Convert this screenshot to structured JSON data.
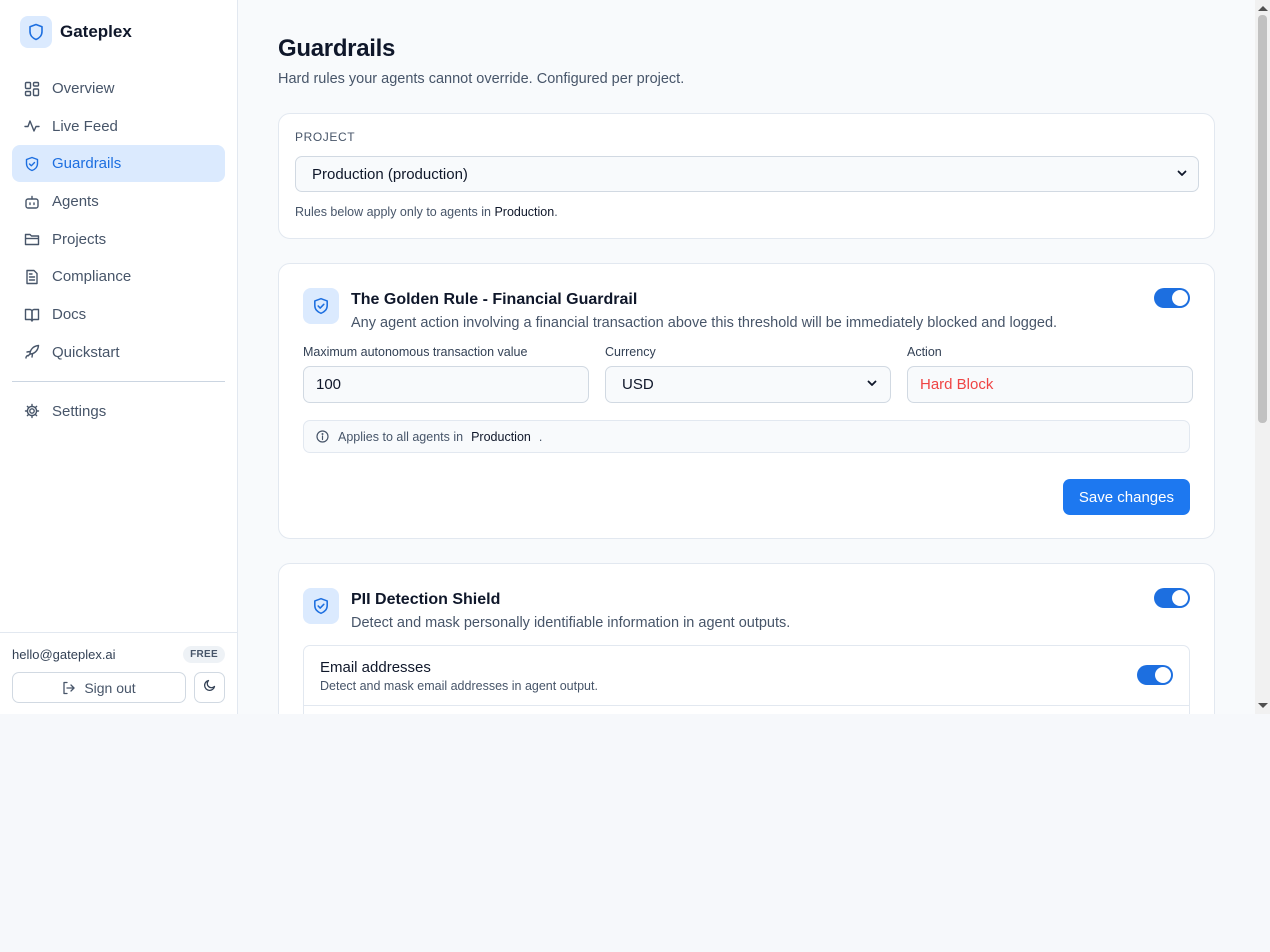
{
  "brand": {
    "name": "Gateplex",
    "icon": "shield-icon"
  },
  "sidebar": {
    "items": [
      {
        "label": "Overview",
        "icon": "dashboard-grid-icon"
      },
      {
        "label": "Live Feed",
        "icon": "activity-icon"
      },
      {
        "label": "Guardrails",
        "icon": "shield-check-icon",
        "active": true
      },
      {
        "label": "Agents",
        "icon": "bot-icon"
      },
      {
        "label": "Projects",
        "icon": "folder-icon"
      },
      {
        "label": "Compliance",
        "icon": "document-icon"
      },
      {
        "label": "Docs",
        "icon": "book-icon"
      },
      {
        "label": "Quickstart",
        "icon": "rocket-icon"
      }
    ],
    "settings_label": "Settings",
    "user_email": "hello@gateplex.ai",
    "plan": "FREE",
    "sign_out_label": "Sign out"
  },
  "page": {
    "title": "Guardrails",
    "subtitle": "Hard rules your agents cannot override. Configured per project."
  },
  "project": {
    "label": "PROJECT",
    "selected": "Production (production)",
    "hint_prefix": "Rules below apply only to agents in ",
    "hint_project": "Production",
    "hint_suffix": "."
  },
  "financial_rule": {
    "title": "The Golden Rule - Financial Guardrail",
    "description": "Any agent action involving a financial transaction above this threshold will be immediately blocked and logged.",
    "enabled": true,
    "max_label": "Maximum autonomous transaction value",
    "max_value": "100",
    "currency_label": "Currency",
    "currency_value": "USD",
    "action_label": "Action",
    "action_value": "Hard Block",
    "applies_prefix": "Applies to all agents in",
    "applies_project": "Production",
    "applies_suffix": ".",
    "save_label": "Save changes"
  },
  "pii_rule": {
    "title": "PII Detection Shield",
    "description": "Detect and mask personally identifiable information in agent outputs.",
    "enabled": true,
    "email_title": "Email addresses",
    "email_desc": "Detect and mask email addresses in agent output.",
    "email_enabled": true
  },
  "colors": {
    "accent": "#1d78f0",
    "danger": "#ef4444",
    "active_bg": "#dbeafe"
  }
}
